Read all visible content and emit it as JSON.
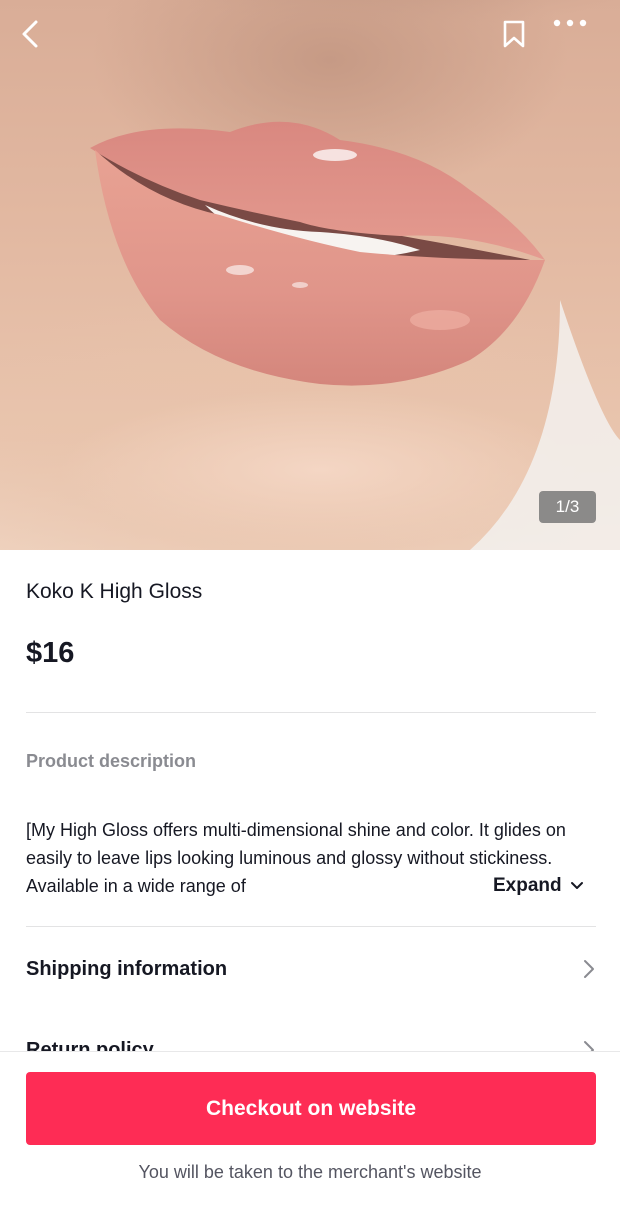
{
  "gallery": {
    "counter": "1/3"
  },
  "product": {
    "name": "Koko K High Gloss",
    "price": "$16"
  },
  "description": {
    "heading": "Product description",
    "text": "[My High Gloss offers multi-dimensional shine and color. It glides on easily to leave lips looking luminous and glossy without stickiness. Available in a wide range of",
    "expand_label": "Expand"
  },
  "sections": {
    "shipping_label": "Shipping information",
    "return_label": "Return policy"
  },
  "checkout": {
    "button_label": "Checkout on website",
    "note": "You will be taken to the merchant's website"
  },
  "colors": {
    "accent": "#fe2c55",
    "text_primary": "#161823",
    "text_secondary": "#8a8b91"
  },
  "icons": {
    "back": "chevron-left-icon",
    "bookmark": "bookmark-icon",
    "more": "more-dots-icon",
    "expand": "chevron-down-icon",
    "row": "chevron-right-icon"
  }
}
